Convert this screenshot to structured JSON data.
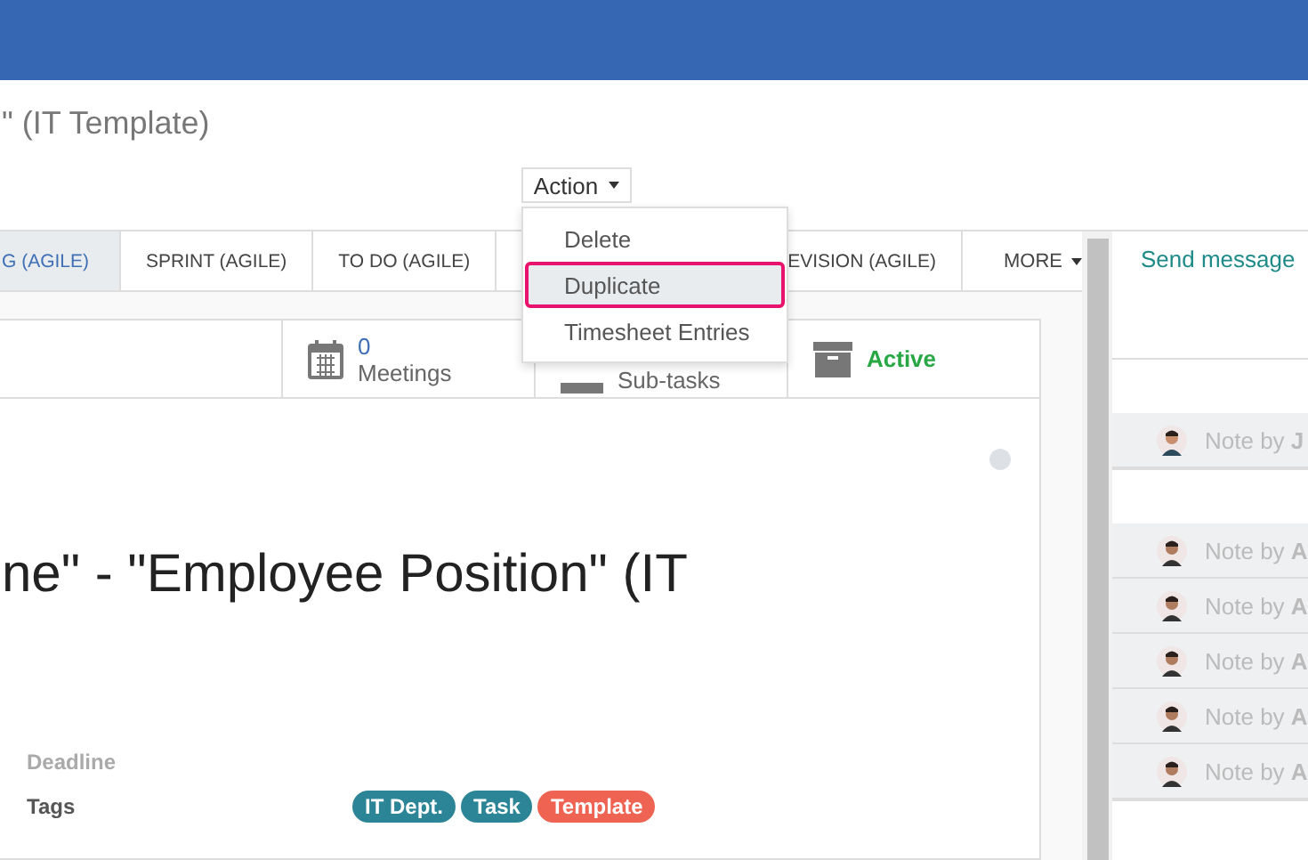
{
  "breadcrumb_title": "\" (IT Template)",
  "action_menu": {
    "label": "Action",
    "open": true,
    "items": [
      {
        "label": "Delete",
        "selected": false
      },
      {
        "label": "Duplicate",
        "selected": true
      },
      {
        "label": "Timesheet Entries",
        "selected": false
      }
    ]
  },
  "stages": [
    {
      "label": "G (AGILE)",
      "selected": true
    },
    {
      "label": "SPRINT (AGILE)",
      "selected": false
    },
    {
      "label": "TO DO (AGILE)",
      "selected": false
    },
    {
      "label": "EVISION (AGILE)",
      "selected": false
    }
  ],
  "more": "MORE",
  "smart_buttons": [
    {
      "kind": "meetings",
      "count": "0",
      "label": "Meetings"
    },
    {
      "kind": "subtasks",
      "label": "Sub-tasks"
    },
    {
      "kind": "active",
      "label": "Active"
    }
  ],
  "title": "ne\" - \"Employee Position\" (IT",
  "fields": [
    {
      "label": "Deadline",
      "muted": true
    },
    {
      "label": "Tags",
      "muted": false,
      "tags": [
        {
          "label": "IT Dept.",
          "color": "#2c8596"
        },
        {
          "label": "Task",
          "color": "#2c8596"
        },
        {
          "label": "Template",
          "color": "#ee6352"
        }
      ]
    }
  ],
  "chatter": {
    "send_message": "Send message",
    "groups": [
      {
        "notes": [
          {
            "text": "Note by **J**"
          }
        ]
      },
      {
        "notes": [
          {
            "text": "Note by **A**"
          },
          {
            "text": "Note by **A**"
          },
          {
            "text": "Note by **A**"
          },
          {
            "text": "Note by **A**"
          },
          {
            "text": "Note by **A**"
          }
        ]
      }
    ]
  }
}
